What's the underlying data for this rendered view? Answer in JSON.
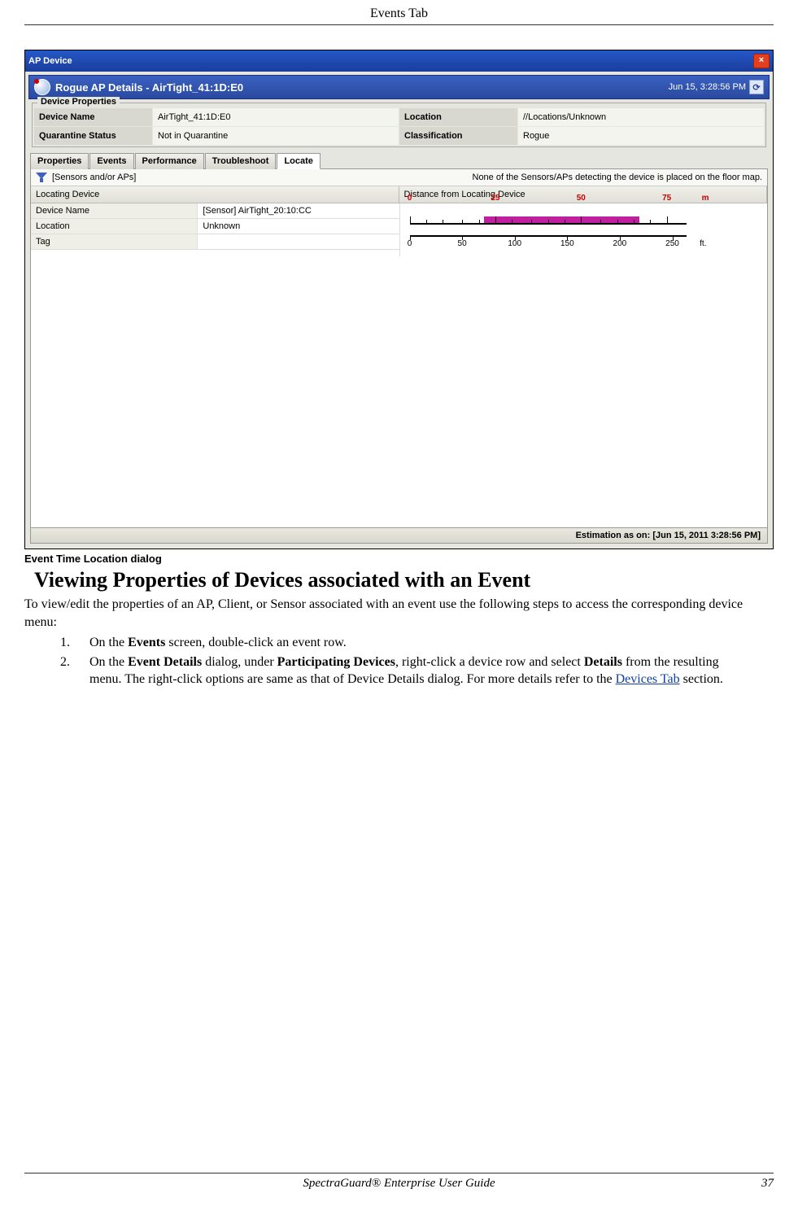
{
  "page": {
    "header": "Events Tab",
    "footer_center": "SpectraGuard® Enterprise User Guide",
    "footer_num": "37"
  },
  "dialog": {
    "outer_title": "AP Device",
    "inner_title": "Rogue AP Details -  AirTight_41:1D:E0",
    "timestamp": "Jun 15, 3:28:56 PM",
    "properties_legend": "Device Properties",
    "props": {
      "device_name_label": "Device Name",
      "device_name_value": "AirTight_41:1D:E0",
      "location_label": "Location",
      "location_value": "//Locations/Unknown",
      "quarantine_label": "Quarantine Status",
      "quarantine_value": "Not in Quarantine",
      "classification_label": "Classification",
      "classification_value": "Rogue"
    },
    "tabs": [
      "Properties",
      "Events",
      "Performance",
      "Troubleshoot",
      "Locate"
    ],
    "active_tab": "Locate",
    "filter_label": "[Sensors and/or APs]",
    "filter_note": "None of the Sensors/APs detecting the device is placed on the floor map.",
    "col_left": "Locating Device",
    "col_right": "Distance from Locating Device",
    "rows": {
      "device_name_label": "Device Name",
      "device_name_value": "[Sensor] AirTight_20:10:CC",
      "location_label": "Location",
      "location_value": "Unknown",
      "tag_label": "Tag",
      "tag_value": ""
    },
    "statusbar": "Estimation as on: [Jun 15, 2011 3:28:56 PM]"
  },
  "chart_data": {
    "type": "bar",
    "title": "Distance from Locating Device",
    "top_axis": {
      "unit": "m",
      "ticks": [
        0,
        25,
        50,
        75
      ],
      "range": [
        0,
        80
      ],
      "highlight_start": 22,
      "highlight_end": 68
    },
    "bottom_axis": {
      "unit": "ft.",
      "ticks": [
        0,
        50,
        100,
        150,
        200,
        250
      ],
      "range": [
        0,
        260
      ]
    }
  },
  "caption": "Event Time Location dialog",
  "section_title": "Viewing Properties of Devices associated with an Event",
  "intro": "To view/edit the properties of an AP, Client, or Sensor associated with an event use the following steps to access the corresponding device menu:",
  "steps": {
    "s1_a": "On the ",
    "s1_b": "Events",
    "s1_c": " screen, double-click an event row.",
    "s2_a": "On the ",
    "s2_b": "Event Details",
    "s2_c": " dialog, under ",
    "s2_d": "Participating Devices",
    "s2_e": ", right-click a device row and select ",
    "s2_f": "Details",
    "s2_g": " from the resulting menu. The right-click options are same as that of Device Details dialog. For more details refer to the ",
    "s2_link": "Devices Tab",
    "s2_h": " section."
  }
}
